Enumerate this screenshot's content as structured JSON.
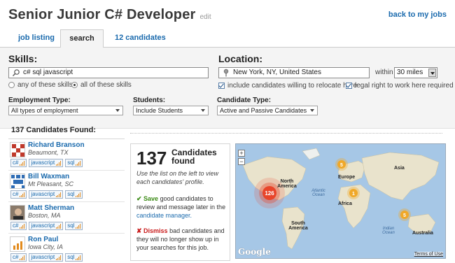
{
  "header": {
    "title": "Senior Junior C# Developer",
    "edit": "edit",
    "back_link": "back to my jobs"
  },
  "tabs": [
    {
      "label": "job listing"
    },
    {
      "label": "search"
    },
    {
      "label": "12 candidates"
    }
  ],
  "skills": {
    "label": "Skills:",
    "value": "c# sql javascript",
    "option_any": "any of these skills",
    "option_all": "all of these skills",
    "selected": "all"
  },
  "location": {
    "label": "Location:",
    "value": "New York, NY, United States",
    "within_label": "within",
    "distance": "30 miles",
    "relocate": "include candidates willing to relocate here",
    "legal": "legal right to work here required"
  },
  "filters": {
    "employment_label": "Employment Type:",
    "employment_value": "All types of employment",
    "students_label": "Students:",
    "students_value": "Include Students",
    "candidate_label": "Candidate Type:",
    "candidate_value": "Active and Passive Candidates"
  },
  "results": {
    "found_title": "137 Candidates Found:",
    "count": "137",
    "count_label": "Candidates found",
    "use_list": "Use the list on the left to view each candidates' profile.",
    "save_word": "Save",
    "save_text": " good candidates to review and message later in the ",
    "save_link": "candidate manager.",
    "dismiss_word": "Dismiss",
    "dismiss_text": " bad candidates and they will no longer show up in your searches for this job."
  },
  "candidates": [
    {
      "name": "Richard Branson",
      "location": "Beaumont, TX",
      "tags": [
        "c#",
        "javascript",
        "sql"
      ]
    },
    {
      "name": "Bill Waxman",
      "location": "Mt Pleasant, SC",
      "tags": [
        "c#",
        "javascript",
        "sql"
      ]
    },
    {
      "name": "Matt Sherman",
      "location": "Boston, MA",
      "tags": [
        "c#",
        "javascript",
        "sql"
      ]
    },
    {
      "name": "Ron Paul",
      "location": "Iowa City, IA",
      "tags": [
        "c#",
        "javascript",
        "sql"
      ]
    }
  ],
  "map": {
    "labels": {
      "north_america": "North America",
      "south_america": "South America",
      "europe": "Europe",
      "asia": "Asia",
      "africa": "Africa",
      "australia": "Australia",
      "atlantic": "Atlantic Ocean",
      "indian": "Indian Ocean"
    },
    "clusters": [
      {
        "label": "126",
        "color": "#e8452a"
      },
      {
        "label": "5",
        "color": "#f0a828"
      },
      {
        "label": "1",
        "color": "#f0a828"
      },
      {
        "label": "5",
        "color": "#f0a828"
      }
    ],
    "zoom_in": "+",
    "zoom_out": "−",
    "brand": "Google",
    "terms": "Terms of Use"
  },
  "colors": {
    "link": "#1a6aad",
    "panel_bg": "#f4f4f4"
  }
}
